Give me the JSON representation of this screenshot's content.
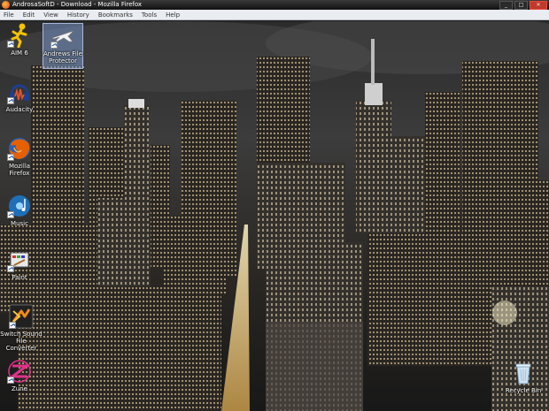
{
  "window": {
    "title": "AndrosaSoftD - Download - Mozilla Firefox",
    "controls": [
      "_",
      "□",
      "✕"
    ]
  },
  "menu": [
    "File",
    "Edit",
    "View",
    "History",
    "Bookmarks",
    "Tools",
    "Help"
  ],
  "desktop": {
    "icons": [
      {
        "label": "AIM 6",
        "icon": "aim-running-man-icon"
      },
      {
        "label": "Andrews File Protector",
        "icon": "airplane-icon",
        "selected": true
      },
      {
        "label": "Audacity",
        "icon": "headphones-waveform-icon"
      },
      {
        "label": "Mozilla Firefox",
        "icon": "firefox-icon"
      },
      {
        "label": "Music",
        "icon": "music-icon"
      },
      {
        "label": "Paint",
        "icon": "paint-icon"
      },
      {
        "label": "Switch Sound File Converter",
        "icon": "switch-converter-icon"
      },
      {
        "label": "Zune",
        "icon": "zune-icon"
      },
      {
        "label": "Recycle Bin",
        "icon": "recycle-bin-icon"
      }
    ]
  },
  "colors": {
    "accent_firefox": "#e66000",
    "aim_yellow": "#f5c400",
    "selection": "#7896c8"
  }
}
